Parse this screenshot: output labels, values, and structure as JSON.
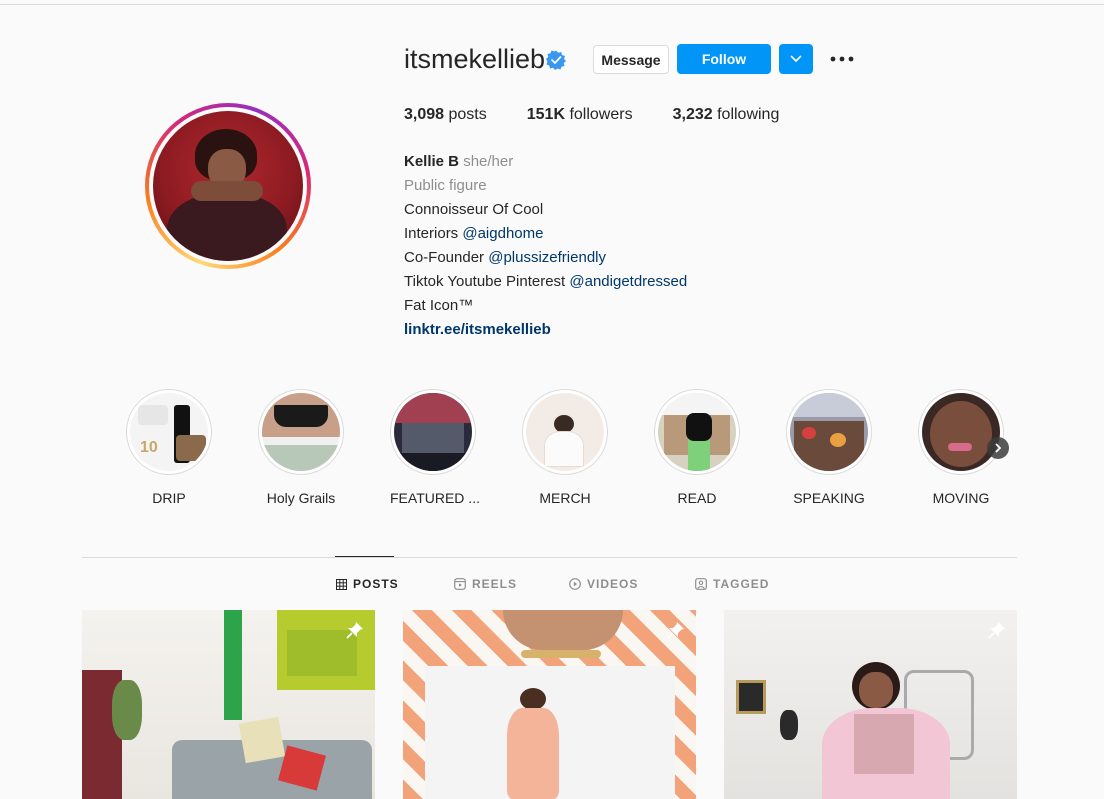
{
  "profile": {
    "username": "itsmekellieb",
    "verified": true,
    "buttons": {
      "message": "Message",
      "follow": "Follow"
    },
    "stats": {
      "posts_count": "3,098",
      "posts_label": "posts",
      "followers_count": "151K",
      "followers_label": "followers",
      "following_count": "3,232",
      "following_label": "following"
    },
    "bio": {
      "name": "Kellie B",
      "pronouns": "she/her",
      "category": "Public figure",
      "line1": "Connoisseur Of Cool",
      "line2_prefix": "Interiors ",
      "line2_mention": "@aigdhome",
      "line3_prefix": "Co-Founder ",
      "line3_mention": "@plussizefriendly",
      "line4_prefix": "Tiktok Youtube Pinterest ",
      "line4_mention": "@andigetdressed",
      "line5": "Fat Icon™",
      "link": "linktr.ee/itsmekellieb"
    }
  },
  "highlights": [
    {
      "label": "DRIP"
    },
    {
      "label": "Holy Grails"
    },
    {
      "label": "FEATURED ..."
    },
    {
      "label": "MERCH"
    },
    {
      "label": "READ"
    },
    {
      "label": "SPEAKING"
    },
    {
      "label": "MOVING"
    }
  ],
  "tabs": [
    {
      "label": "POSTS",
      "icon": "grid-icon",
      "active": true
    },
    {
      "label": "REELS",
      "icon": "reels-icon",
      "active": false
    },
    {
      "label": "VIDEOS",
      "icon": "play-circle-icon",
      "active": false
    },
    {
      "label": "TAGGED",
      "icon": "tagged-icon",
      "active": false
    }
  ],
  "posts": [
    {
      "pinned": true
    },
    {
      "pinned": true
    },
    {
      "pinned": true
    }
  ],
  "colors": {
    "accent": "#0095f6",
    "link": "#00376b",
    "muted": "#8e8e8e",
    "text": "#262626",
    "background": "#fafafa"
  }
}
